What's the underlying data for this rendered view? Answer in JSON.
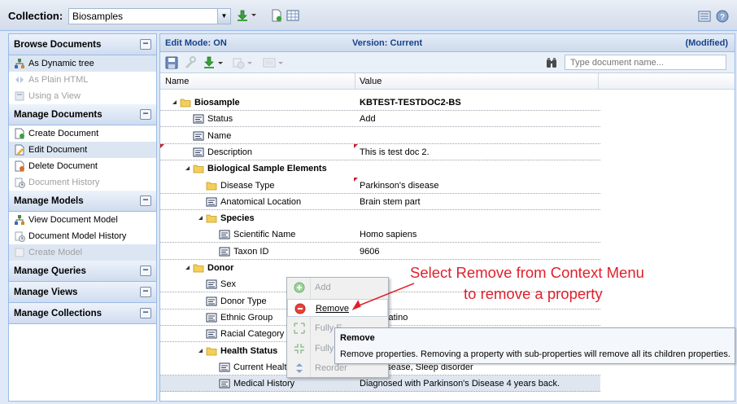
{
  "collection": {
    "label": "Collection:",
    "selected": "Biosamples",
    "icons": [
      "download-icon",
      "add-document-icon",
      "grid-icon"
    ],
    "right_icons": [
      "layout-icon",
      "help-icon"
    ]
  },
  "sidebar": {
    "sections": [
      {
        "title": "Browse Documents",
        "items": [
          {
            "label": "As Dynamic tree",
            "icon": "tree-icon",
            "disabled": false,
            "selected": true
          },
          {
            "label": "As Plain HTML",
            "icon": "html-icon",
            "disabled": true
          },
          {
            "label": "Using a View",
            "icon": "view-icon",
            "disabled": true
          }
        ]
      },
      {
        "title": "Manage Documents",
        "items": [
          {
            "label": "Create Document",
            "icon": "create-document-icon",
            "disabled": false
          },
          {
            "label": "Edit Document",
            "icon": "edit-document-icon",
            "disabled": false,
            "selected": true
          },
          {
            "label": "Delete Document",
            "icon": "delete-document-icon",
            "disabled": false
          },
          {
            "label": "Document History",
            "icon": "history-icon",
            "disabled": true
          }
        ]
      },
      {
        "title": "Manage Models",
        "items": [
          {
            "label": "View Document Model",
            "icon": "tree-icon",
            "disabled": false
          },
          {
            "label": "Document Model History",
            "icon": "history-icon",
            "disabled": false
          },
          {
            "label": "Create Model",
            "icon": "create-model-icon",
            "disabled": true,
            "selected": true
          }
        ]
      },
      {
        "title": "Manage Queries",
        "items": []
      },
      {
        "title": "Manage Views",
        "items": []
      },
      {
        "title": "Manage Collections",
        "items": []
      }
    ]
  },
  "main": {
    "edit_mode": "Edit Mode: ON",
    "version": "Version: Current",
    "modified": "(Modified)",
    "search_placeholder": "Type document name...",
    "columns": {
      "name": "Name",
      "value": "Value"
    },
    "rows": [
      {
        "name": "Biosample",
        "value": "KBTEST-TESTDOC2-BS",
        "depth": 0,
        "type": "folder",
        "bold": true,
        "bold_value": true
      },
      {
        "name": "Status",
        "value": "Add",
        "depth": 1,
        "type": "property"
      },
      {
        "name": "Name",
        "value": "",
        "depth": 1,
        "type": "property"
      },
      {
        "name": "Description",
        "value": "This is test doc 2.",
        "depth": 1,
        "type": "property",
        "dirty_name": true,
        "dirty_value": true
      },
      {
        "name": "Biological Sample Elements",
        "value": "",
        "depth": 1,
        "type": "folder",
        "bold": true
      },
      {
        "name": "Disease Type",
        "value": "Parkinson's disease",
        "depth": 2,
        "type": "folder-leaf",
        "dirty_value": true
      },
      {
        "name": "Anatomical Location",
        "value": "Brain stem part",
        "depth": 2,
        "type": "property"
      },
      {
        "name": "Species",
        "value": "",
        "depth": 2,
        "type": "folder",
        "bold": true
      },
      {
        "name": "Scientific Name",
        "value": "Homo sapiens",
        "depth": 3,
        "type": "property"
      },
      {
        "name": "Taxon ID",
        "value": "9606",
        "depth": 3,
        "type": "property"
      },
      {
        "name": "Donor",
        "value": "",
        "depth": 1,
        "type": "folder",
        "bold": true
      },
      {
        "name": "Sex",
        "value": "",
        "depth": 2,
        "type": "property"
      },
      {
        "name": "Donor Type",
        "value": "ental",
        "depth": 2,
        "type": "property"
      },
      {
        "name": "Ethnic Group",
        "value": "panic/Latino",
        "depth": 2,
        "type": "property"
      },
      {
        "name": "Racial Category",
        "value": "",
        "depth": 2,
        "type": "property"
      },
      {
        "name": "Health Status",
        "value": "",
        "depth": 2,
        "type": "folder",
        "bold": true
      },
      {
        "name": "Current Health",
        "value": "on's Disease, Sleep disorder",
        "depth": 3,
        "type": "property"
      },
      {
        "name": "Medical History",
        "value": "Diagnosed with Parkinson's Disease 4 years back.",
        "depth": 3,
        "type": "property",
        "highlight": true
      }
    ]
  },
  "context_menu": {
    "items": [
      {
        "label": "Add",
        "icon": "add-icon",
        "disabled": true
      },
      {
        "label": "Remove",
        "icon": "remove-icon",
        "disabled": false,
        "active": true
      },
      {
        "label": "Fully E",
        "icon": "expand-icon",
        "disabled": true
      },
      {
        "label": "Fully C",
        "icon": "collapse-icon",
        "disabled": true
      },
      {
        "label": "Reorder",
        "icon": "reorder-icon",
        "disabled": true
      }
    ]
  },
  "tooltip": {
    "title": "Remove",
    "body": "Remove properties. Removing a property with sub-properties will remove all its children properties."
  },
  "annotation": {
    "line1": "Select Remove from Context Menu",
    "line2": "to remove a property",
    "color": "#e0202c"
  }
}
